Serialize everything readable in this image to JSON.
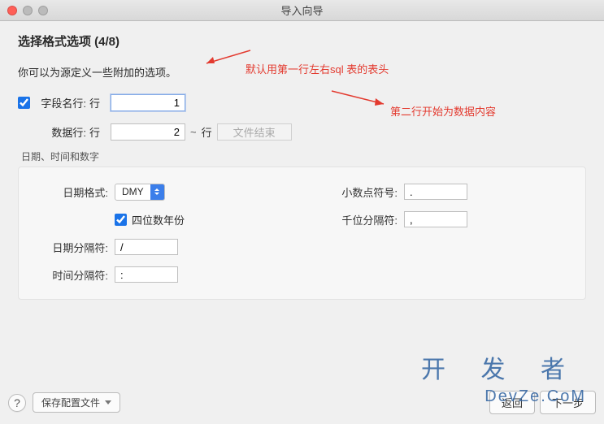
{
  "window": {
    "title": "导入向导"
  },
  "heading": "选择格式选项 (4/8)",
  "subtext": "你可以为源定义一些附加的选项。",
  "fieldNameRow": {
    "checkbox_checked": true,
    "label": "字段名行:",
    "unit": "行",
    "value": "1"
  },
  "dataRow": {
    "label": "数据行:",
    "unit": "行",
    "value": "2",
    "to_unit": "行",
    "end_placeholder": "文件结束"
  },
  "annotations": {
    "one": "默认用第一行左右sql 表的表头",
    "two": "第二行开始为数据内容"
  },
  "groupLabel": "日期、时间和数字",
  "left": {
    "dateFormat": {
      "label": "日期格式:",
      "value": "DMY"
    },
    "fourDigitYear": {
      "checked": true,
      "label": "四位数年份"
    },
    "dateSep": {
      "label": "日期分隔符:",
      "value": "/"
    },
    "timeSep": {
      "label": "时间分隔符:",
      "value": ":"
    }
  },
  "right": {
    "decimal": {
      "label": "小数点符号:",
      "value": "."
    },
    "thousand": {
      "label": "千位分隔符:",
      "value": ","
    }
  },
  "footer": {
    "help": "?",
    "save": "保存配置文件",
    "back": "返回",
    "next": "下一步"
  },
  "watermark": {
    "cn": "开 发 者",
    "en": "DevZe.CoM"
  }
}
